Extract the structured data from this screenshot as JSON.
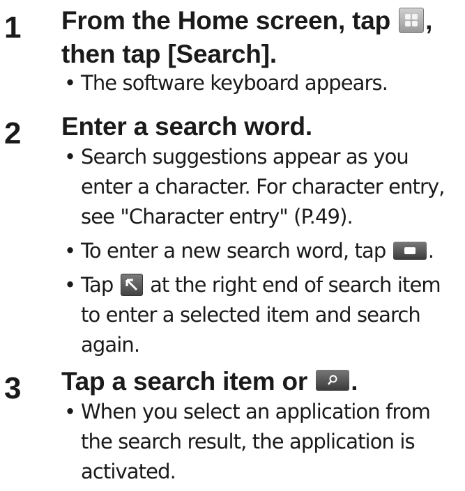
{
  "steps": [
    {
      "number": "1",
      "title_parts": [
        "From the Home screen, tap ",
        ",",
        "then tap [Search]."
      ],
      "title_icon": "apps-icon",
      "bullets": [
        "The software keyboard appears."
      ]
    },
    {
      "number": "2",
      "title": "Enter a search word.",
      "bullets": [
        "Search suggestions appear as you enter a character. For character entry, see \"Character entry\" (P.49).",
        "To enter a new search word, tap",
        "Tap",
        "at the right end of search item to enter a selected item and search again."
      ],
      "bullet_icons": [
        "delete-key-icon",
        "up-left-arrow-icon"
      ],
      "bullet2_suffix": "."
    },
    {
      "number": "3",
      "title_parts": [
        "Tap a search item or ",
        "."
      ],
      "title_icon": "search-key-icon",
      "bullets": [
        "When you select an application from the search result, the application is activated."
      ]
    }
  ],
  "bullet_symbol": "•"
}
